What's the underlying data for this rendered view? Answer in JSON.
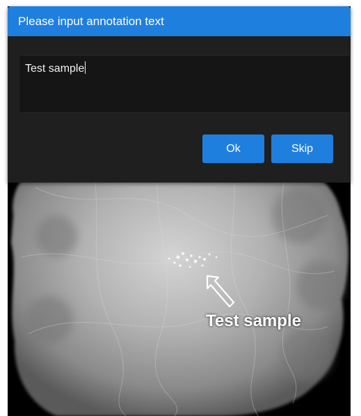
{
  "dialog": {
    "title": "Please input annotation text",
    "input_value": "Test sample",
    "ok_label": "Ok",
    "skip_label": "Skip"
  },
  "image": {
    "annotation_text": "Test sample",
    "annotation_icon": "arrow-up-left-icon"
  },
  "colors": {
    "accent": "#1f7fdf",
    "dialog_background": "#1f1f1f",
    "input_background": "#151515",
    "image_background": "#000000"
  }
}
